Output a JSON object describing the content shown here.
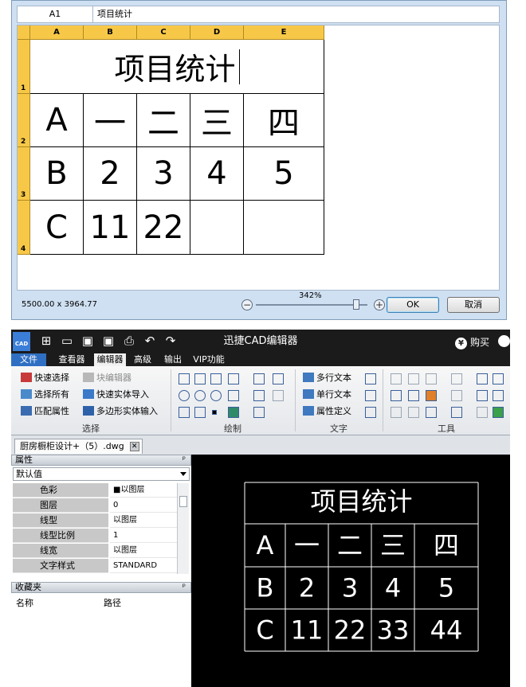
{
  "dialog": {
    "cell_ref": "A1",
    "cell_edit": "项目统计",
    "columns": [
      "A",
      "B",
      "C",
      "D",
      "E"
    ],
    "rows": [
      "1",
      "2",
      "3",
      "4"
    ],
    "title_cell": "项目统计",
    "table": [
      [
        "A",
        "一",
        "二",
        "三",
        "四"
      ],
      [
        "B",
        "2",
        "3",
        "4",
        "5"
      ],
      [
        "C",
        "11",
        "22",
        "",
        ""
      ]
    ],
    "status_dims": "5500.00 x 3964.77",
    "zoom_label": "342%",
    "zoom_level_percent": 90,
    "ok_label": "OK",
    "cancel_label": "取消"
  },
  "app": {
    "logo_text": "CAD",
    "title": "迅捷CAD编辑器",
    "buy_label": "购买",
    "buy_icon": "yen-icon",
    "accent_color": "#2f6fc3",
    "tabs": [
      "文件",
      "查看器",
      "编辑器",
      "高级",
      "输出",
      "VIP功能"
    ],
    "active_tab": "编辑器",
    "ribbon": {
      "select_group": {
        "label": "选择",
        "items": [
          "快速选择",
          "选择所有",
          "匹配属性",
          "块编辑器",
          "快速实体导入",
          "多边形实体输入"
        ]
      },
      "draw_group": {
        "label": "绘制"
      },
      "text_group": {
        "label": "文字",
        "items": [
          "多行文本",
          "单行文本",
          "属性定义"
        ]
      },
      "tools_group": {
        "label": "工具"
      }
    },
    "doc_tab": "厨房橱柜设计+（5）.dwg",
    "properties": {
      "header": "属性",
      "selector": "默认值",
      "rows": [
        {
          "key": "色彩",
          "value": "■以图层"
        },
        {
          "key": "图层",
          "value": "0"
        },
        {
          "key": "线型",
          "value": "以图层"
        },
        {
          "key": "线型比例",
          "value": "1"
        },
        {
          "key": "线宽",
          "value": "以图层"
        },
        {
          "key": "文字样式",
          "value": "STANDARD"
        }
      ]
    },
    "favorites": {
      "header": "收藏夹",
      "col_name": "名称",
      "col_path": "路径"
    },
    "drawing": {
      "title": "项目统计",
      "table": [
        [
          "A",
          "一",
          "二",
          "三",
          "四"
        ],
        [
          "B",
          "2",
          "3",
          "4",
          "5"
        ],
        [
          "C",
          "11",
          "22",
          "33",
          "44"
        ]
      ]
    }
  }
}
